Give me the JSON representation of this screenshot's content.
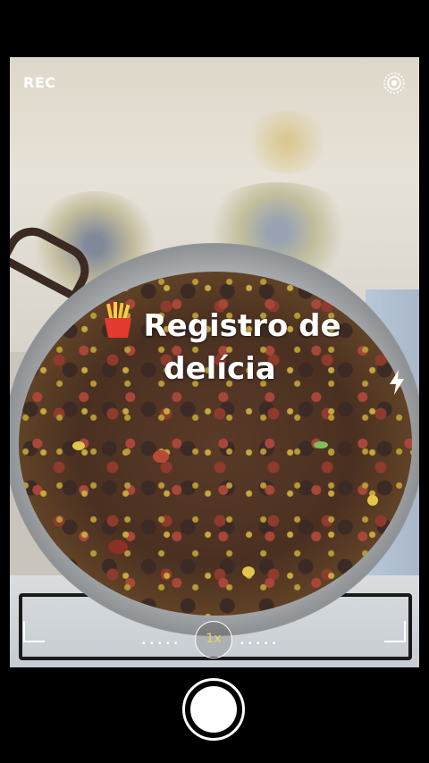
{
  "status": {
    "rec_label": "REC"
  },
  "sticker": {
    "emoji_icon": "fries-icon",
    "line1": "Registro de",
    "line2": "delícia"
  },
  "controls": {
    "zoom_label": "1x",
    "zoom_dots_left": "•••••",
    "zoom_dots_right": "•••••",
    "icons": [
      "live-photo-icon",
      "flash-icon",
      "shutter-button"
    ]
  },
  "colors": {
    "zoom_accent": "#f3d35a",
    "overlay_text": "#ffffff",
    "background": "#000000"
  }
}
